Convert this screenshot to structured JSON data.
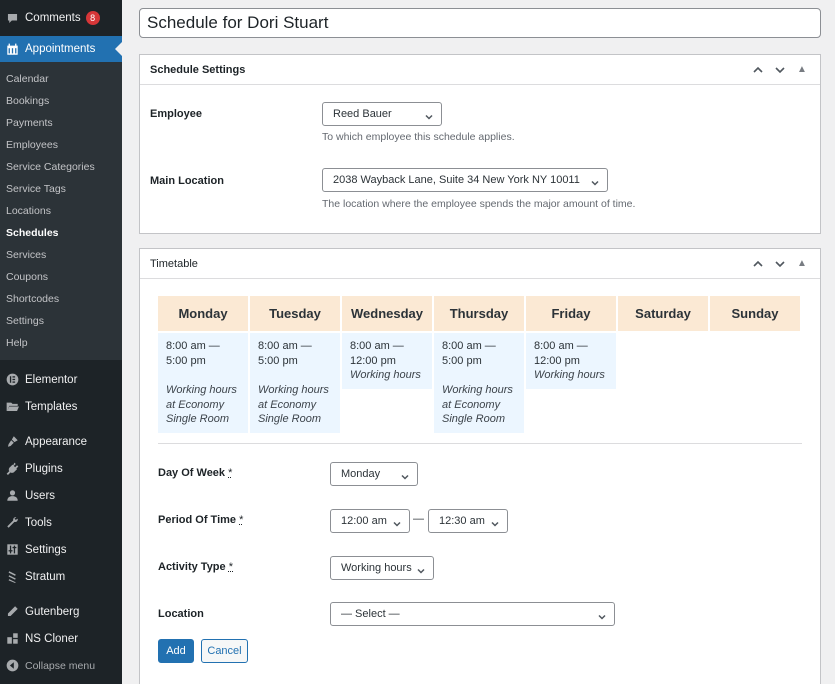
{
  "sidebar": {
    "comments": {
      "label": "Comments",
      "badge": "8",
      "icon": "comment-icon"
    },
    "appointments": {
      "label": "Appointments",
      "icon": "calendar-icon"
    },
    "submenu": [
      "Calendar",
      "Bookings",
      "Payments",
      "Employees",
      "Service Categories",
      "Service Tags",
      "Locations",
      "Schedules",
      "Services",
      "Coupons",
      "Shortcodes",
      "Settings",
      "Help"
    ],
    "active_submenu": "Schedules",
    "items": [
      {
        "label": "Elementor",
        "icon": "elementor-icon"
      },
      {
        "label": "Templates",
        "icon": "folder-icon"
      },
      {
        "label": "Appearance",
        "icon": "paintbrush-icon"
      },
      {
        "label": "Plugins",
        "icon": "plugin-icon"
      },
      {
        "label": "Users",
        "icon": "user-icon"
      },
      {
        "label": "Tools",
        "icon": "wrench-icon"
      },
      {
        "label": "Settings",
        "icon": "settings-icon"
      },
      {
        "label": "Stratum",
        "icon": "stratum-icon"
      },
      {
        "label": "Gutenberg",
        "icon": "pencil-icon"
      },
      {
        "label": "NS Cloner",
        "icon": "cloner-icon"
      },
      {
        "label": "Collapse menu",
        "icon": "collapse-icon"
      }
    ]
  },
  "title": "Schedule for Dori Stuart",
  "schedule_settings": {
    "heading": "Schedule Settings",
    "employee": {
      "label": "Employee",
      "value": "Reed Bauer",
      "description": "To which employee this schedule applies."
    },
    "main_location": {
      "label": "Main Location",
      "value": "2038 Wayback Lane, Suite 34 New York NY 10011",
      "description": "The location where the employee spends the major amount of time."
    }
  },
  "timetable": {
    "heading": "Timetable",
    "days": [
      {
        "name": "Monday",
        "slots": [
          {
            "time": "8:00 am — 5:00 pm",
            "note": "Working hours at Economy Single Room"
          }
        ]
      },
      {
        "name": "Tuesday",
        "slots": [
          {
            "time": "8:00 am — 5:00 pm",
            "note": "Working hours at Economy Single Room"
          }
        ]
      },
      {
        "name": "Wednesday",
        "slots": [
          {
            "time": "8:00 am — 12:00 pm",
            "note": "Working hours"
          }
        ]
      },
      {
        "name": "Thursday",
        "slots": [
          {
            "time": "8:00 am — 5:00 pm",
            "note": "Working hours at Economy Single Room"
          }
        ]
      },
      {
        "name": "Friday",
        "slots": [
          {
            "time": "8:00 am — 12:00 pm",
            "note": "Working hours"
          }
        ]
      },
      {
        "name": "Saturday",
        "slots": []
      },
      {
        "name": "Sunday",
        "slots": []
      }
    ],
    "form": {
      "day_of_week": {
        "label": "Day Of Week",
        "required": "*",
        "value": "Monday"
      },
      "period": {
        "label": "Period Of Time",
        "required": "*",
        "start": "12:00 am",
        "separator": "—",
        "end": "12:30 am"
      },
      "activity_type": {
        "label": "Activity Type",
        "required": "*",
        "value": "Working hours"
      },
      "location": {
        "label": "Location",
        "value": "— Select —"
      },
      "add_label": "Add",
      "cancel_label": "Cancel"
    }
  },
  "colors": {
    "sidebar_bg": "#1d2327",
    "submenu_bg": "#2c3338",
    "accent": "#2271b1",
    "badge": "#d63638",
    "day_header": "#fbe9d4",
    "slot_bg": "#ecf6ff"
  }
}
